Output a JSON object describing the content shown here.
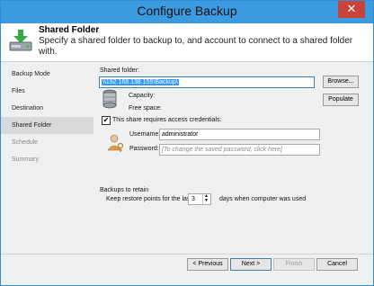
{
  "window": {
    "title": "Configure Backup",
    "close_glyph": "✕"
  },
  "header": {
    "title": "Shared Folder",
    "description": "Specify a shared folder to backup to, and account to connect to a shared folder with."
  },
  "nav": {
    "items": [
      {
        "label": "Backup Mode",
        "state": "normal"
      },
      {
        "label": "Files",
        "state": "normal"
      },
      {
        "label": "Destination",
        "state": "normal"
      },
      {
        "label": "Shared Folder",
        "state": "active"
      },
      {
        "label": "Schedule",
        "state": "disabled"
      },
      {
        "label": "Summary",
        "state": "disabled"
      }
    ]
  },
  "main": {
    "shared_folder_label": "Shared folder:",
    "shared_folder_value": "\\\\192.168.138.155\\Backup\\",
    "browse_label": "Browse...",
    "capacity_label": "Capacity:",
    "free_space_label": "Free space:",
    "populate_label": "Populate",
    "credentials_checkbox_label": "This share requires access credentials:",
    "credentials_checked": true,
    "username_label": "Username:",
    "username_value": "administrator",
    "password_label": "Password:",
    "password_placeholder": "[To change the saved password, click here]",
    "retain_section_label": "Backups to retain",
    "retain_prefix": "Keep restore points for the last",
    "retain_value": "3",
    "retain_suffix": "days when computer was used"
  },
  "footer": {
    "previous_label": "< Previous",
    "next_label": "Next >",
    "finish_label": "Finish",
    "cancel_label": "Cancel"
  },
  "colors": {
    "titlebar": "#3c9ae0",
    "close_button": "#c7433c",
    "selection": "#3399ff",
    "active_nav": "#d9d9d9"
  }
}
